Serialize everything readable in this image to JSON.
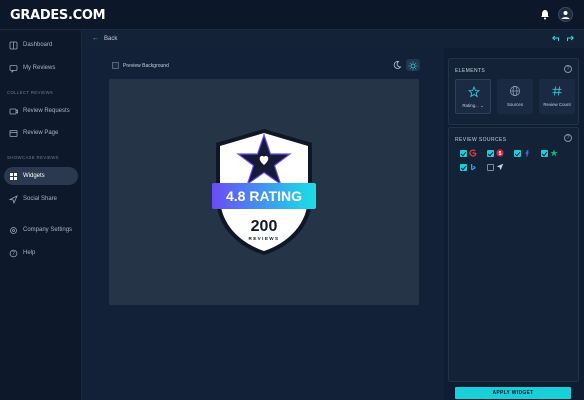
{
  "app": {
    "logo": "GRADES.COM"
  },
  "header": {
    "bell_icon": "bell-icon",
    "avatar_icon": "user-icon"
  },
  "sidebar": {
    "items": [
      {
        "label": "Dashboard",
        "icon": "dashboard-icon"
      },
      {
        "label": "My Reviews",
        "icon": "message-icon"
      },
      {
        "label": "Review Requests",
        "icon": "send-icon"
      },
      {
        "label": "Review Page",
        "icon": "page-icon"
      },
      {
        "label": "Widgets",
        "icon": "widgets-icon",
        "active": true
      },
      {
        "label": "Social Share",
        "icon": "share-icon"
      },
      {
        "label": "Company Settings",
        "icon": "gear-icon"
      },
      {
        "label": "Help",
        "icon": "help-icon"
      }
    ],
    "sections": {
      "collect": "COLLECT REVIEWS",
      "showcase": "SHOWCASE REVIEWS"
    }
  },
  "toolbar": {
    "back_label": "Back"
  },
  "preview": {
    "background_label": "Preview Background",
    "badge": {
      "rating_text": "4.8 RATING",
      "count": "200",
      "count_label": "REVIEWS"
    }
  },
  "elements_panel": {
    "title": "ELEMENTS",
    "tiles": [
      {
        "label": "Rating...",
        "icon": "star-icon",
        "selected": true
      },
      {
        "label": "Sources",
        "icon": "globe-icon"
      },
      {
        "label": "Review Count",
        "icon": "hash-icon"
      }
    ]
  },
  "sources_panel": {
    "title": "REVIEW SOURCES",
    "sources": [
      {
        "name": "google-icon",
        "checked": true
      },
      {
        "name": "yelp-icon",
        "checked": true
      },
      {
        "name": "facebook-icon",
        "checked": true
      },
      {
        "name": "trustpilot-icon",
        "checked": true
      },
      {
        "name": "bing-icon",
        "checked": true
      },
      {
        "name": "direct-icon",
        "checked": false
      }
    ]
  },
  "apply_button": "APPLY WIDGET",
  "colors": {
    "accent": "#19d0d9",
    "badge_gradient_start": "#6a4cf5",
    "badge_gradient_end": "#18e0e6"
  }
}
